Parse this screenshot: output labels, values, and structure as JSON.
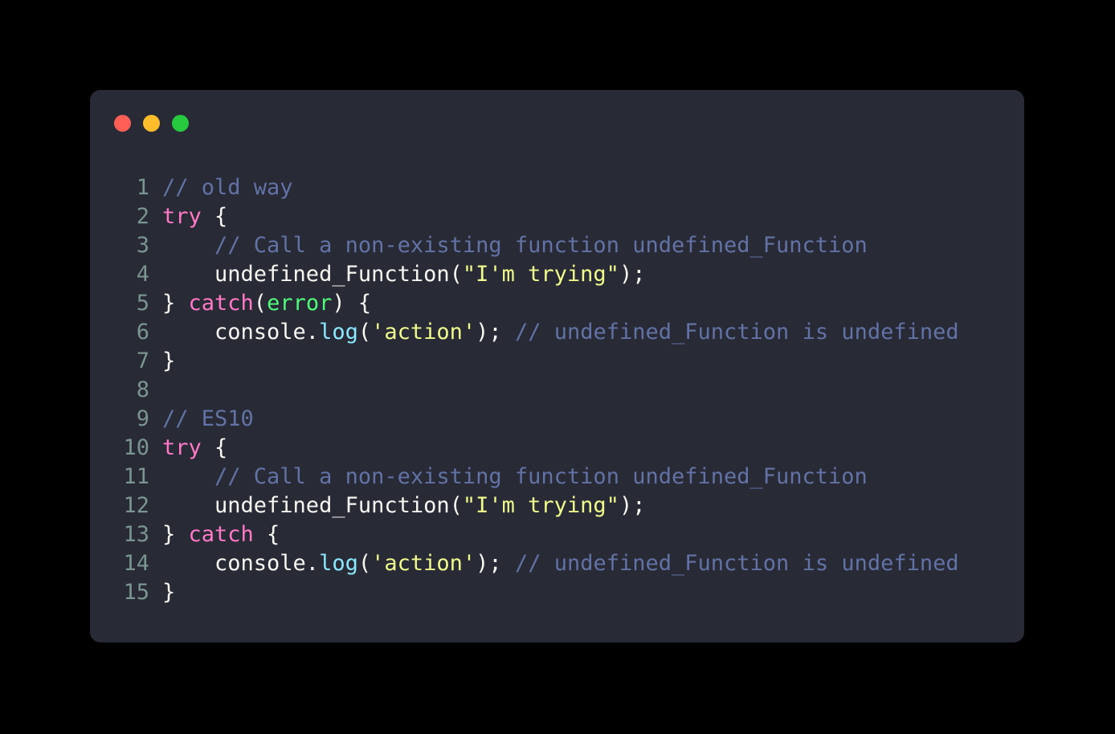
{
  "window": {
    "background_color": "#282a36",
    "page_background_color": "#000000",
    "corner_radius_px": 13,
    "traffic_lights": [
      {
        "name": "close",
        "color": "#ff5f56"
      },
      {
        "name": "minimize",
        "color": "#ffbd2e"
      },
      {
        "name": "zoom",
        "color": "#27c93f"
      }
    ]
  },
  "theme": {
    "plain": "#f8f8f2",
    "comment": "#6272a4",
    "keyword": "#ff79c6",
    "string": "#f1fa8c",
    "method": "#8be9fd",
    "param": "#50fa7b",
    "gutter": "#7a9490"
  },
  "editor": {
    "language": "javascript",
    "first_line_number": 1,
    "last_line_number": 15,
    "plain_text": "// old way\ntry {\n    // Call a non-existing function undefined_Function\n    undefined_Function(\"I'm trying\");\n} catch(error) {\n    console.log('action'); // undefined_Function is undefined\n}\n\n// ES10\ntry {\n    // Call a non-existing function undefined_Function\n    undefined_Function(\"I'm trying\");\n} catch {\n    console.log('action'); // undefined_Function is undefined\n}",
    "lines": [
      {
        "number": "1",
        "tokens": [
          {
            "text": "// old way",
            "type": "comment"
          }
        ]
      },
      {
        "number": "2",
        "tokens": [
          {
            "text": "try",
            "type": "keyword"
          },
          {
            "text": " {",
            "type": "plain"
          }
        ]
      },
      {
        "number": "3",
        "tokens": [
          {
            "text": "    ",
            "type": "plain"
          },
          {
            "text": "// Call a non-existing function undefined_Function",
            "type": "comment"
          }
        ]
      },
      {
        "number": "4",
        "tokens": [
          {
            "text": "    undefined_Function(",
            "type": "plain"
          },
          {
            "text": "\"I'm trying\"",
            "type": "string"
          },
          {
            "text": ");",
            "type": "plain"
          }
        ]
      },
      {
        "number": "5",
        "tokens": [
          {
            "text": "} ",
            "type": "plain"
          },
          {
            "text": "catch",
            "type": "keyword"
          },
          {
            "text": "(",
            "type": "plain"
          },
          {
            "text": "error",
            "type": "param"
          },
          {
            "text": ") {",
            "type": "plain"
          }
        ]
      },
      {
        "number": "6",
        "tokens": [
          {
            "text": "    console.",
            "type": "plain"
          },
          {
            "text": "log",
            "type": "method"
          },
          {
            "text": "(",
            "type": "plain"
          },
          {
            "text": "'action'",
            "type": "string"
          },
          {
            "text": "); ",
            "type": "plain"
          },
          {
            "text": "// undefined_Function is undefined",
            "type": "comment"
          }
        ]
      },
      {
        "number": "7",
        "tokens": [
          {
            "text": "}",
            "type": "plain"
          }
        ]
      },
      {
        "number": "8",
        "tokens": [
          {
            "text": "",
            "type": "plain"
          }
        ]
      },
      {
        "number": "9",
        "tokens": [
          {
            "text": "// ES10",
            "type": "comment"
          }
        ]
      },
      {
        "number": "10",
        "tokens": [
          {
            "text": "try",
            "type": "keyword"
          },
          {
            "text": " {",
            "type": "plain"
          }
        ]
      },
      {
        "number": "11",
        "tokens": [
          {
            "text": "    ",
            "type": "plain"
          },
          {
            "text": "// Call a non-existing function undefined_Function",
            "type": "comment"
          }
        ]
      },
      {
        "number": "12",
        "tokens": [
          {
            "text": "    undefined_Function(",
            "type": "plain"
          },
          {
            "text": "\"I'm trying\"",
            "type": "string"
          },
          {
            "text": ");",
            "type": "plain"
          }
        ]
      },
      {
        "number": "13",
        "tokens": [
          {
            "text": "} ",
            "type": "plain"
          },
          {
            "text": "catch",
            "type": "keyword"
          },
          {
            "text": " {",
            "type": "plain"
          }
        ]
      },
      {
        "number": "14",
        "tokens": [
          {
            "text": "    console.",
            "type": "plain"
          },
          {
            "text": "log",
            "type": "method"
          },
          {
            "text": "(",
            "type": "plain"
          },
          {
            "text": "'action'",
            "type": "string"
          },
          {
            "text": "); ",
            "type": "plain"
          },
          {
            "text": "// undefined_Function is undefined",
            "type": "comment"
          }
        ]
      },
      {
        "number": "15",
        "tokens": [
          {
            "text": "}",
            "type": "plain"
          }
        ]
      }
    ]
  }
}
